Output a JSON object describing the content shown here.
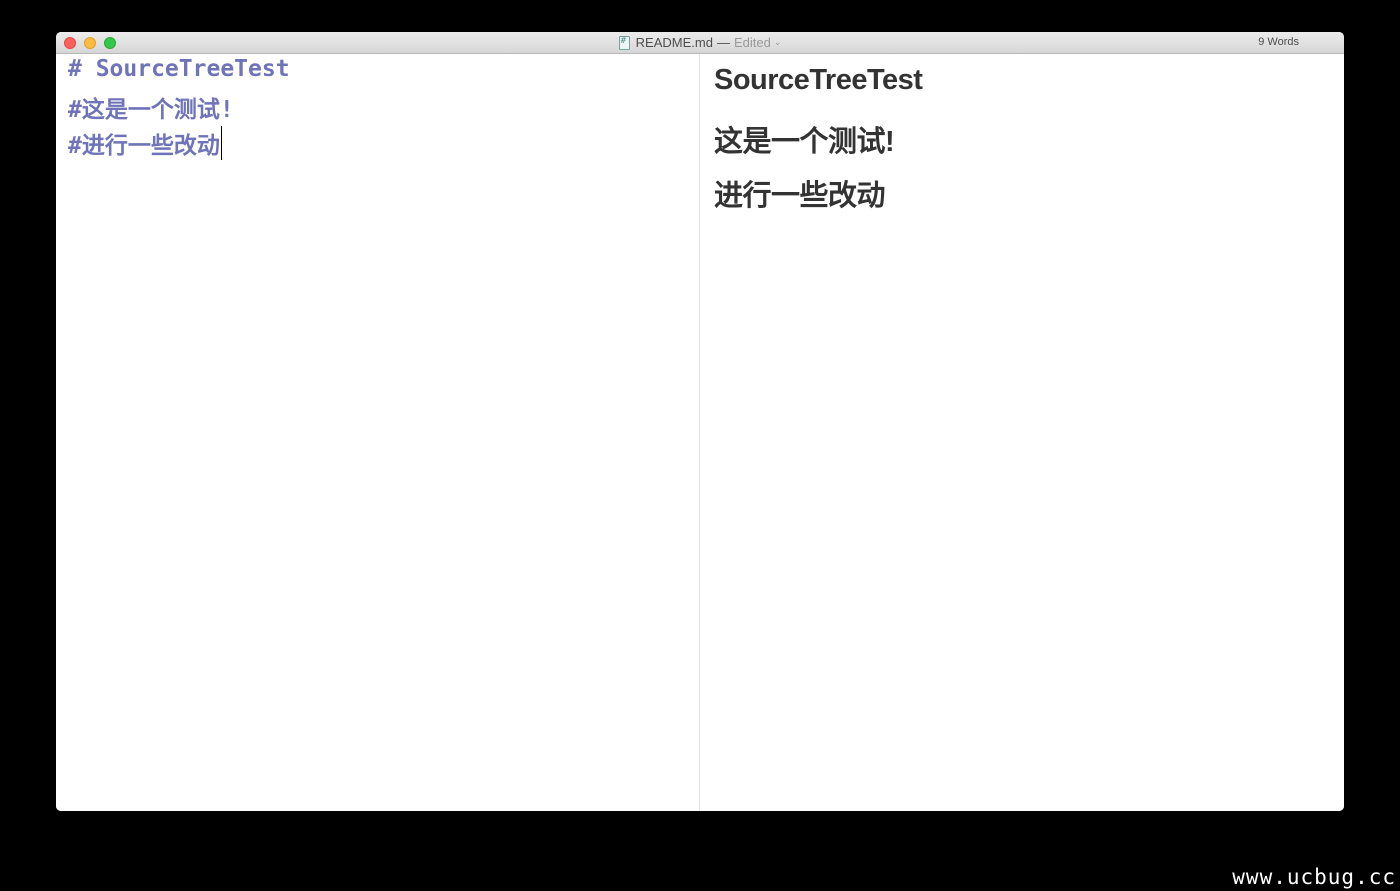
{
  "window": {
    "filename": "README.md",
    "separator": "—",
    "status": "Edited",
    "word_count": "9 Words"
  },
  "editor": {
    "lines": [
      "# SourceTreeTest",
      "#这是一个测试!",
      "#进行一些改动"
    ]
  },
  "preview": {
    "headings": [
      "SourceTreeTest",
      "这是一个测试!",
      "进行一些改动"
    ]
  },
  "watermark": "www.ucbug.cc",
  "colors": {
    "editor_text": "#6f73b8",
    "preview_text": "#333333",
    "background": "#000000"
  }
}
